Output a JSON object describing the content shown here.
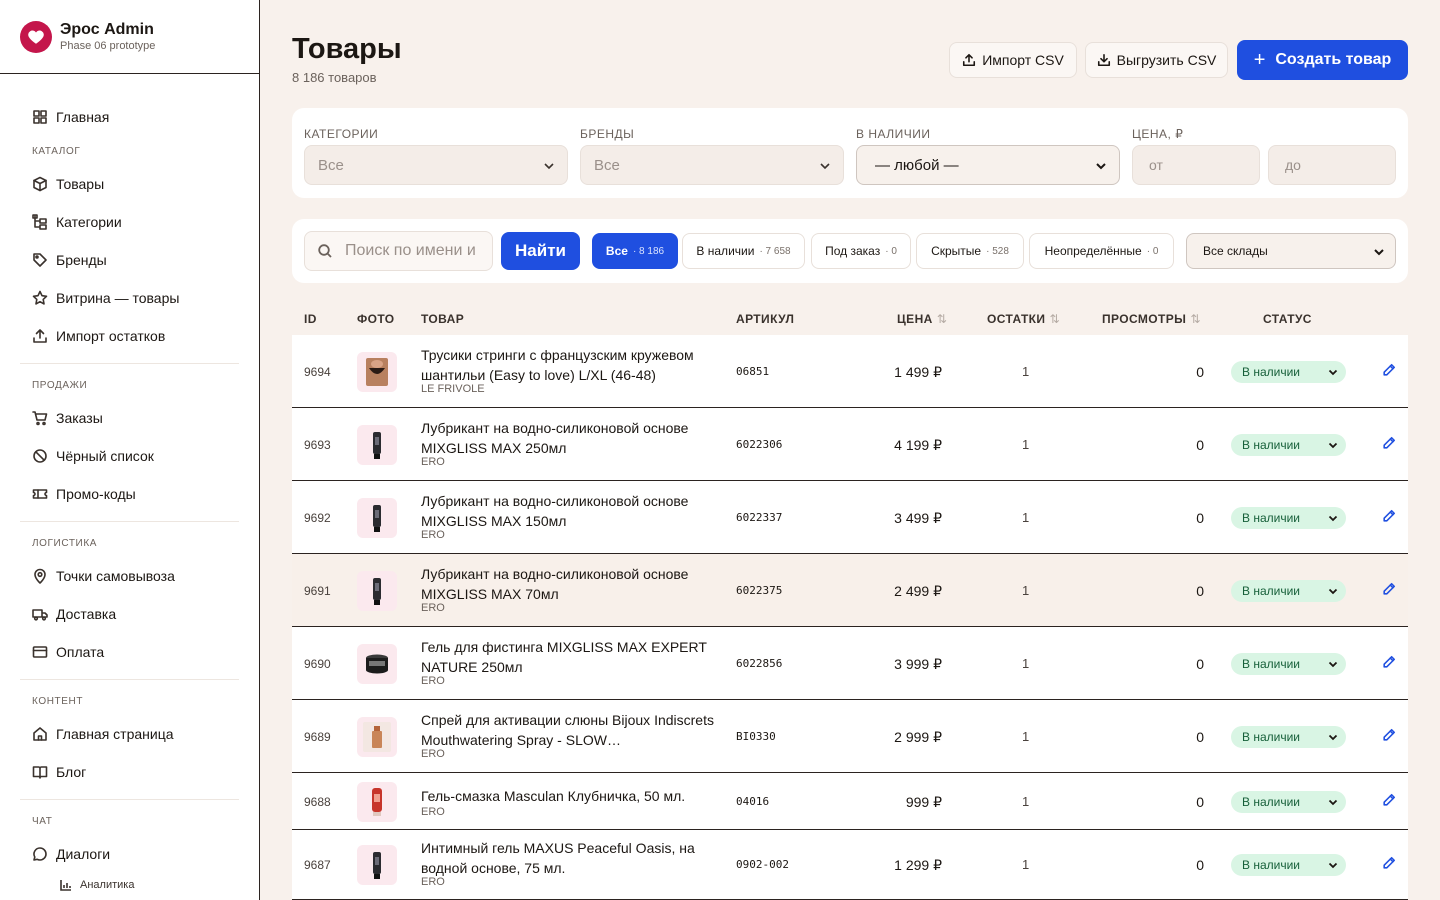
{
  "brand": {
    "title": "Эрос Admin",
    "subtitle": "Phase 06 prototype"
  },
  "sidebar": {
    "home": "Главная",
    "sections": {
      "catalog": "КАТАЛОГ",
      "sales": "ПРОДАЖИ",
      "logistics": "ЛОГИСТИКА",
      "content": "КОНТЕНТ",
      "chat": "ЧАТ"
    },
    "catalog": [
      "Товары",
      "Категории",
      "Бренды",
      "Витрина — товары",
      "Импорт остатков"
    ],
    "sales": [
      "Заказы",
      "Чёрный список",
      "Промо-коды"
    ],
    "logistics": [
      "Точки самовывоза",
      "Доставка",
      "Оплата"
    ],
    "content": [
      "Главная страница",
      "Блог"
    ],
    "chat": [
      "Диалоги"
    ],
    "chat_sub": [
      "Аналитика"
    ]
  },
  "page": {
    "title": "Товары",
    "count": "8 186 товаров",
    "import_label": "Импорт CSV",
    "export_label": "Выгрузить CSV",
    "create_label": "Создать товар"
  },
  "filters": {
    "categories_label": "КАТЕГОРИИ",
    "categories_value": "Все",
    "brands_label": "БРЕНДЫ",
    "brands_value": "Все",
    "stock_label": "В НАЛИЧИИ",
    "stock_value": "— любой —",
    "price_label": "ЦЕНА, ₽",
    "price_from_placeholder": "от",
    "price_to_placeholder": "до"
  },
  "search": {
    "placeholder": "Поиск по имени и",
    "button": "Найти"
  },
  "tabs": [
    {
      "label": "Все",
      "count": "· 8 186"
    },
    {
      "label": "В наличии",
      "count": "· 7 658"
    },
    {
      "label": "Под заказ",
      "count": "· 0"
    },
    {
      "label": "Скрытые",
      "count": "· 528"
    },
    {
      "label": "Неопределённые",
      "count": "· 0"
    }
  ],
  "warehouse": "Все склады",
  "table": {
    "headers": {
      "id": "ID",
      "photo": "ФОТО",
      "product": "ТОВАР",
      "sku": "АРТИКУЛ",
      "price": "ЦЕНА",
      "stock": "ОСТАТКИ",
      "views": "ПРОСМОТРЫ",
      "status": "СТАТУС"
    },
    "sort_glyph": "⇅",
    "rows": [
      {
        "id": "9694",
        "name": "Трусики стринги с французским кружевом шантильи (Easy to love) L/XL (46-48)",
        "brand": "LE FRIVOLE",
        "sku": "06851",
        "price": "1 499 ₽",
        "stock": "1",
        "views": "0",
        "status": "В наличии",
        "photo": "lingerie"
      },
      {
        "id": "9693",
        "name": "Лубрикант на водно-силиконовой основе MIXGLISS MAX 250мл",
        "brand": "ERO",
        "sku": "6022306",
        "price": "4 199 ₽",
        "stock": "1",
        "views": "0",
        "status": "В наличии",
        "photo": "tube"
      },
      {
        "id": "9692",
        "name": "Лубрикант на водно-силиконовой основе MIXGLISS MAX 150мл",
        "brand": "ERO",
        "sku": "6022337",
        "price": "3 499 ₽",
        "stock": "1",
        "views": "0",
        "status": "В наличии",
        "photo": "tube"
      },
      {
        "id": "9691",
        "name": "Лубрикант на водно-силиконовой основе MIXGLISS MAX 70мл",
        "brand": "ERO",
        "sku": "6022375",
        "price": "2 499 ₽",
        "stock": "1",
        "views": "0",
        "status": "В наличии",
        "photo": "tube"
      },
      {
        "id": "9690",
        "name": "Гель для фистинга MIXGLISS MAX EXPERT NATURE 250мл",
        "brand": "ERO",
        "sku": "6022856",
        "price": "3 999 ₽",
        "stock": "1",
        "views": "0",
        "status": "В наличии",
        "photo": "jar"
      },
      {
        "id": "9689",
        "name": "Спрей для активации слюны Bijoux Indiscrets Mouthwatering Spray - SLOW…",
        "brand": "ERO",
        "sku": "BI0330",
        "price": "2 999 ₽",
        "stock": "1",
        "views": "0",
        "status": "В наличии",
        "photo": "spray"
      },
      {
        "id": "9688",
        "name": "Гель-смазка Masculan Клубничка, 50 мл.",
        "brand": "ERO",
        "sku": "04016",
        "price": "999 ₽",
        "stock": "1",
        "views": "0",
        "status": "В наличии",
        "photo": "redtube"
      },
      {
        "id": "9687",
        "name": "Интимный гель MAXUS Peaceful Oasis, на водной основе, 75 мл.",
        "brand": "ERO",
        "sku": "0902-002",
        "price": "1 299 ₽",
        "stock": "1",
        "views": "0",
        "status": "В наличии",
        "photo": "tube"
      }
    ]
  }
}
